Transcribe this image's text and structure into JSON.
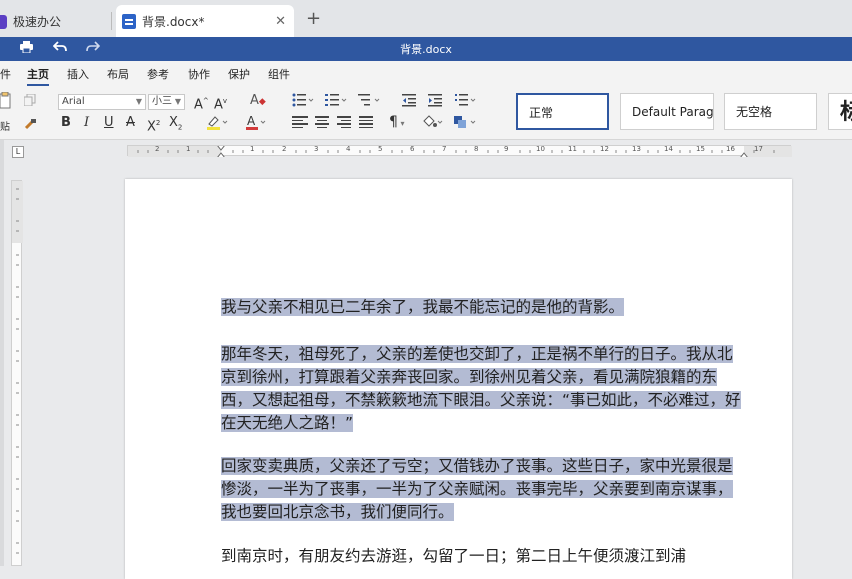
{
  "tabs": {
    "inactive_label": "极速办公",
    "active_label": "背景.docx*",
    "close_symbol": "✕",
    "add_symbol": "+"
  },
  "titlebar": {
    "title": "背景.docx",
    "color": "#2f57a0"
  },
  "menu": {
    "items": [
      "件",
      "主页",
      "插入",
      "布局",
      "参考",
      "协作",
      "保护",
      "组件"
    ],
    "active": "主页"
  },
  "ribbon": {
    "paste_label": "贴",
    "font_name": "Arial",
    "font_size": "小三",
    "styles": [
      "正常",
      "Default Paragi",
      "无空格",
      "标"
    ]
  },
  "ruler": {
    "numbers": [
      "2",
      "1",
      "1",
      "2",
      "3",
      "4",
      "5",
      "6",
      "7",
      "8",
      "9",
      "10",
      "11",
      "12",
      "13",
      "14",
      "15",
      "16",
      "17"
    ],
    "corner": "L"
  },
  "document": {
    "paragraphs": [
      "我与父亲不相见已二年余了，我最不能忘记的是他的背影。",
      "那年冬天，祖母死了，父亲的差使也交卸了，正是祸不单行的日子。我从北京到徐州，打算跟着父亲奔丧回家。到徐州见着父亲，看见满院狼籍的东西，又想起祖母，不禁簌簌地流下眼泪。父亲说：“事已如此，不必难过，好在天无绝人之路！”",
      "回家变卖典质，父亲还了亏空；又借钱办了丧事。这些日子，家中光景很是惨淡，一半为了丧事，一半为了父亲赋闲。丧事完毕，父亲要到南京谋事，我也要回北京念书，我们便同行。",
      "到南京时，有朋友约去游逛，勾留了一日；第二日上午便须渡江到浦"
    ]
  }
}
